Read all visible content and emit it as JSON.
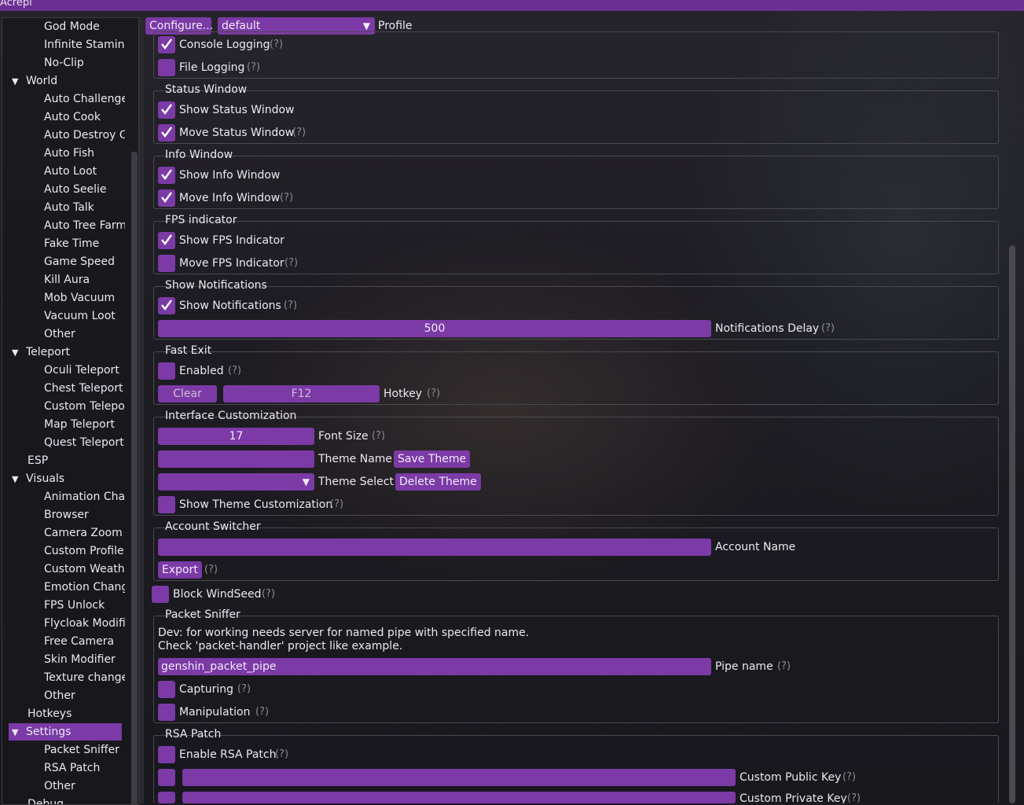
{
  "window": {
    "title": "Acrepi"
  },
  "toolbar": {
    "configure": "Configure...",
    "profile_value": "default",
    "profile_label": "Profile"
  },
  "sidebar": {
    "items": [
      {
        "label": "God Mode"
      },
      {
        "label": "Infinite Stamina"
      },
      {
        "label": "No-Clip"
      },
      {
        "label": "World"
      },
      {
        "label": "Auto Challenge"
      },
      {
        "label": "Auto Cook"
      },
      {
        "label": "Auto Destroy Objects"
      },
      {
        "label": "Auto Fish"
      },
      {
        "label": "Auto Loot"
      },
      {
        "label": "Auto Seelie"
      },
      {
        "label": "Auto Talk"
      },
      {
        "label": "Auto Tree Farm"
      },
      {
        "label": "Fake Time"
      },
      {
        "label": "Game Speed"
      },
      {
        "label": "Kill Aura"
      },
      {
        "label": "Mob Vacuum"
      },
      {
        "label": "Vacuum Loot"
      },
      {
        "label": "Other"
      },
      {
        "label": "Teleport"
      },
      {
        "label": "Oculi Teleport"
      },
      {
        "label": "Chest Teleport"
      },
      {
        "label": "Custom Teleports"
      },
      {
        "label": "Map Teleport"
      },
      {
        "label": "Quest Teleport"
      },
      {
        "label": "ESP"
      },
      {
        "label": "Visuals"
      },
      {
        "label": "Animation Changer"
      },
      {
        "label": "Browser"
      },
      {
        "label": "Camera Zoom"
      },
      {
        "label": "Custom Profile"
      },
      {
        "label": "Custom Weather"
      },
      {
        "label": "Emotion Changer"
      },
      {
        "label": "FPS Unlock"
      },
      {
        "label": "Flycloak Modifier"
      },
      {
        "label": "Free Camera"
      },
      {
        "label": "Skin Modifier"
      },
      {
        "label": "Texture changer"
      },
      {
        "label": "Other"
      },
      {
        "label": "Hotkeys"
      },
      {
        "label": "Settings"
      },
      {
        "label": "Packet Sniffer"
      },
      {
        "label": "RSA Patch"
      },
      {
        "label": "Other"
      },
      {
        "label": "Debug"
      }
    ]
  },
  "logging": {
    "console": "Console Logging",
    "file": "File Logging"
  },
  "status_window": {
    "title": "Status Window",
    "show": "Show Status Window",
    "move": "Move Status Window"
  },
  "info_window": {
    "title": "Info Window",
    "show": "Show Info Window",
    "move": "Move Info Window"
  },
  "fps": {
    "title": "FPS indicator",
    "show": "Show FPS Indicator",
    "move": "Move FPS Indicator"
  },
  "notifications": {
    "title": "Show Notifications",
    "show": "Show Notifications",
    "delay_value": "500",
    "delay_label": "Notifications Delay"
  },
  "fast_exit": {
    "title": "Fast Exit",
    "enabled": "Enabled",
    "clear": "Clear",
    "key": "F12",
    "hotkey_label": "Hotkey"
  },
  "interface": {
    "title": "Interface Customization",
    "font_size_value": "17",
    "font_size_label": "Font Size",
    "theme_name_label": "Theme Name",
    "save_theme": "Save Theme",
    "theme_select_label": "Theme Select",
    "delete_theme": "Delete Theme",
    "show_theme": "Show Theme Customization"
  },
  "account": {
    "title": "Account Switcher",
    "name_label": "Account Name",
    "export": "Export"
  },
  "block_windseed": "Block WindSeed",
  "packet_sniffer": {
    "title": "Packet Sniffer",
    "note1": "Dev: for working needs server for named pipe with specified name.",
    "note2": "Check 'packet-handler' project like example.",
    "pipe_value": "genshin_packet_pipe",
    "pipe_label": "Pipe name",
    "capturing": "Capturing",
    "manipulation": "Manipulation"
  },
  "rsa": {
    "title": "RSA Patch",
    "enable": "Enable RSA Patch",
    "public_key": "Custom Public Key",
    "private_key": "Custom Private Key"
  },
  "help_mark": "(?)",
  "colors": {
    "accent": "#7b3aa6",
    "titlebar": "#6a2f92",
    "selected": "#7a3aa8"
  }
}
